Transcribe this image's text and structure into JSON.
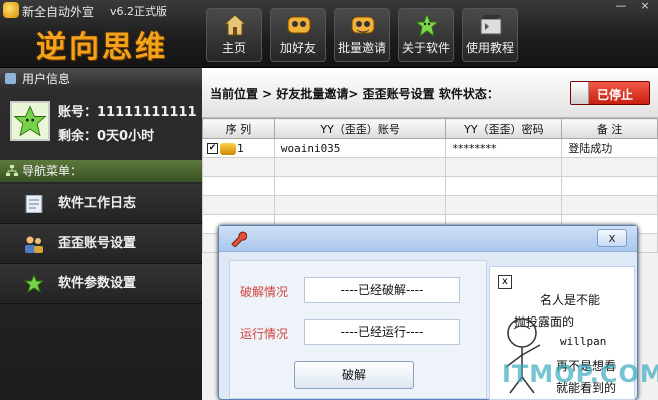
{
  "app": {
    "title": "新全自动外宣",
    "version": "v6.2正式版",
    "big_title": "逆向思维"
  },
  "toolbar": [
    {
      "label": "主页",
      "icon": "home-icon"
    },
    {
      "label": "加好友",
      "icon": "add-friend-icon"
    },
    {
      "label": "批量邀请",
      "icon": "batch-invite-icon"
    },
    {
      "label": "关于软件",
      "icon": "about-icon"
    },
    {
      "label": "使用教程",
      "icon": "tutorial-icon"
    }
  ],
  "window_controls": {
    "minimize": "—",
    "close": "×"
  },
  "user_info": {
    "header": "用户信息",
    "account_line": "账号：11111111111",
    "remaining_line": "剩余：0天0小时"
  },
  "nav": {
    "header": "导航菜单：",
    "items": [
      {
        "label": "软件工作日志",
        "icon": "log-icon"
      },
      {
        "label": "歪歪账号设置",
        "icon": "account-settings-icon"
      },
      {
        "label": "软件参数设置",
        "icon": "params-settings-icon"
      }
    ]
  },
  "breadcrumb": "当前位置 > 好友批量邀请> 歪歪账号设置 软件状态：",
  "status_button": "已停止",
  "table": {
    "headers": [
      "序 列",
      "YY（歪歪）账号",
      "YY（歪歪）密码",
      "备 注"
    ],
    "rows": [
      {
        "index": "1",
        "checked": true,
        "account": "woaini035",
        "password": "********",
        "note": "登陆成功"
      }
    ]
  },
  "dialog": {
    "close_label": "x",
    "crack_label": "破解情况",
    "crack_value": "----已经破解----",
    "run_label": "运行情况",
    "run_value": "----已经运行----",
    "button": "破解",
    "ad_close": "x",
    "ad_lines": [
      "名人是不能",
      "抛投露面的",
      "willpan",
      "再不是想看",
      "就能看到的"
    ]
  },
  "watermark": "ITMOP.COM",
  "colors": {
    "accent_orange": "#f3a21a",
    "stop_red": "#d8281a",
    "dialog_blue": "#a9c6ea"
  }
}
